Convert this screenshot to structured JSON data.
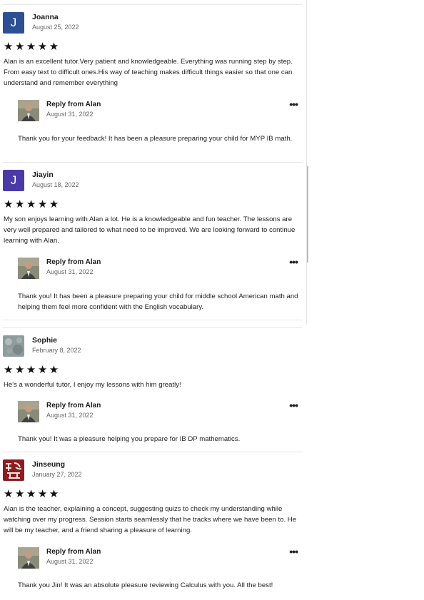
{
  "reviews": [
    {
      "name": "Joanna",
      "initial": "J",
      "avatar_color": "#2d4f93",
      "date": "August 25, 2022",
      "stars": "★★★★★",
      "rating": 5,
      "text": "Alan is an excellent tutor.Very patient and knowledgeable. Everything was running step by step. From easy text to difficult ones.His way of teaching makes difficult things easier so that one can understand and remember everything",
      "reply": {
        "title": "Reply from Alan",
        "date": "August 31, 2022",
        "more": "•••",
        "text": "Thank you for your feedback! It has been a pleasure preparing your child for MYP IB math."
      }
    },
    {
      "name": "Jiayin",
      "initial": "J",
      "avatar_color": "#4a3aa9",
      "date": "August 18, 2022",
      "stars": "★★★★★",
      "rating": 5,
      "text": "My son enjoys learning with Alan a lot. He is a knowledgeable and fun teacher. The lessons are very well prepared and tailored to what need to be improved. We are looking forward to continue learning with Alan.",
      "reply": {
        "title": "Reply from Alan",
        "date": "August 31, 2022",
        "more": "•••",
        "text": "Thank you! It has been a pleasure preparing your child for middle school American math and helping them feel more confident with the English vocabulary."
      }
    },
    {
      "name": "Sophie",
      "date": "February 8, 2022",
      "stars": "★★★★★",
      "rating": 5,
      "text": "He's a wonderful tutor, I enjoy my lessons with him greatly!",
      "reply": {
        "title": "Reply from Alan",
        "date": "August 31, 2022",
        "more": "•••",
        "text": "Thank you! It was a pleasure helping you prepare for IB DP mathematics."
      }
    },
    {
      "name": "Jinseung",
      "date": "January 27, 2022",
      "stars": "★★★★★",
      "rating": 5,
      "text": "Alan is the teacher, explaining a concept, suggesting quizs to check my understanding while watching over my progress. Session starts seamlessly that he tracks where we have been to. He will be my teacher, and a friend sharing a pleasure of learning.",
      "reply": {
        "title": "Reply from Alan",
        "date": "August 31, 2022",
        "more": "•••",
        "text": "Thank you Jin! It was an absolute pleasure reviewing Calculus with you. All the best!"
      }
    }
  ]
}
